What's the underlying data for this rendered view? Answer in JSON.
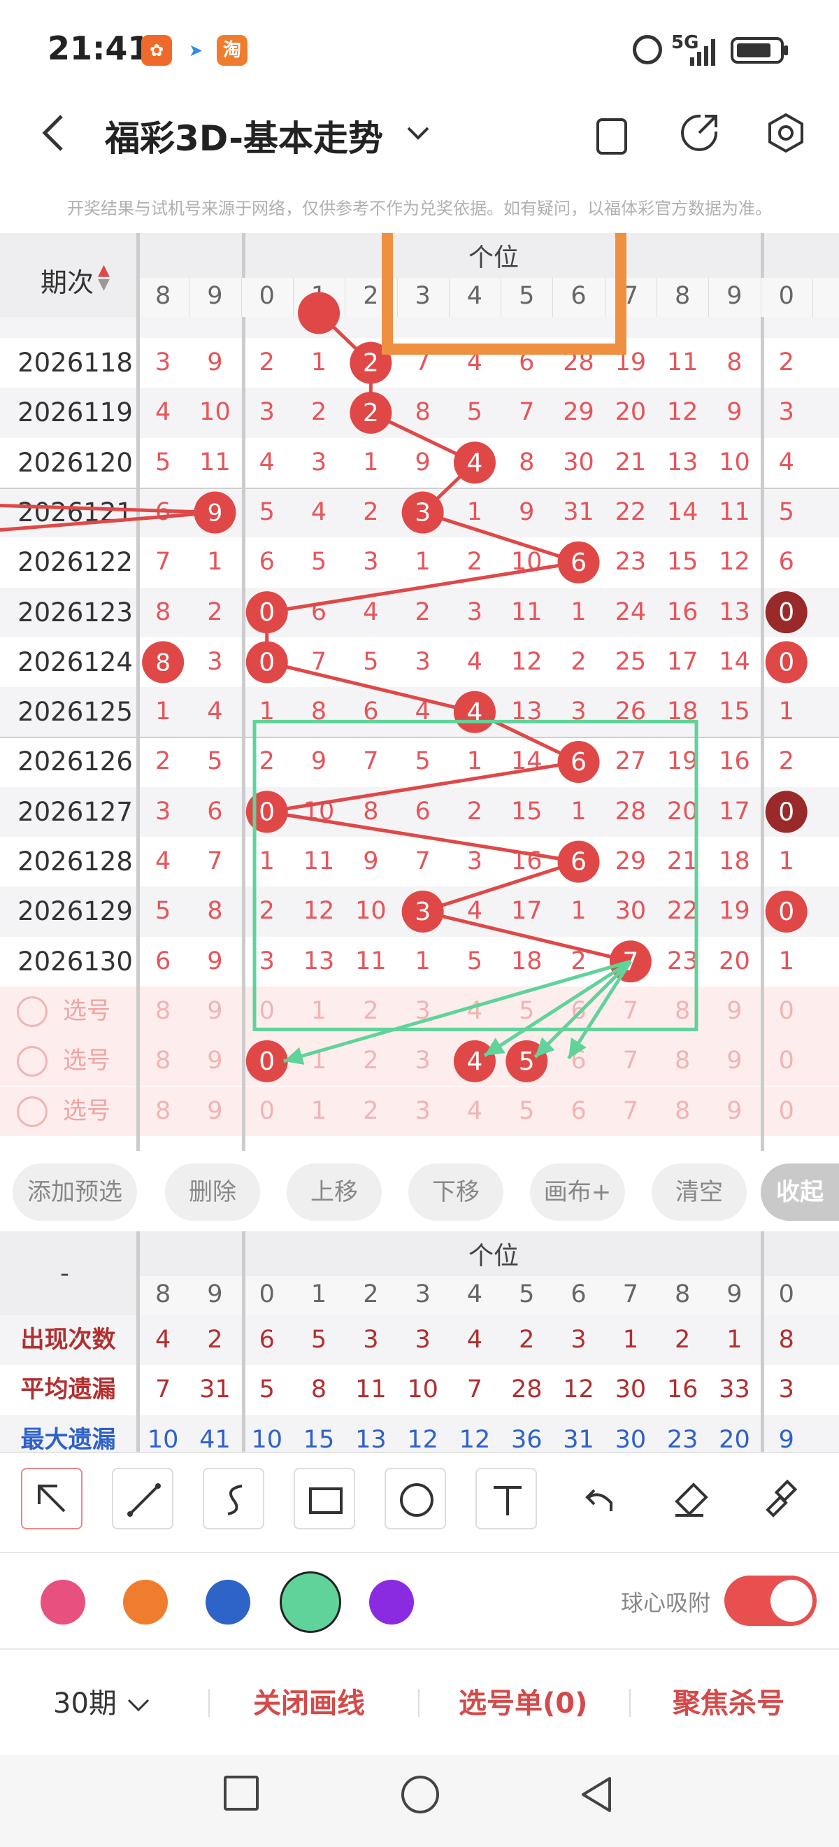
{
  "status_bar": {
    "time": "21:41",
    "signal": "5G",
    "app_icons": [
      "photo-app-icon",
      "bird-app-icon",
      "taobao-app-icon"
    ]
  },
  "header": {
    "title": "福彩3D-基本走势",
    "notice": "开奖结果与试机号来源于网络，仅供参考不作为兑奖依据。如有疑问，以福体彩官方数据为准。"
  },
  "table": {
    "period_header": "期次",
    "group_label": "个位",
    "columns": [
      "8",
      "9",
      "0",
      "1",
      "2",
      "3",
      "4",
      "5",
      "6",
      "7",
      "8",
      "9",
      "0"
    ],
    "rows": [
      {
        "period": "2026118",
        "cells": [
          "3",
          "9",
          "2",
          "1",
          "2",
          "7",
          "4",
          "6",
          "28",
          "19",
          "11",
          "8",
          "2"
        ],
        "ball_index": 4,
        "ball_value": "2"
      },
      {
        "period": "2026119",
        "cells": [
          "4",
          "10",
          "3",
          "2",
          "2",
          "8",
          "5",
          "7",
          "29",
          "20",
          "12",
          "9",
          "3"
        ],
        "ball_index": 4,
        "ball_value": "2"
      },
      {
        "period": "2026120",
        "cells": [
          "5",
          "11",
          "4",
          "3",
          "1",
          "9",
          "4",
          "8",
          "30",
          "21",
          "13",
          "10",
          "4"
        ],
        "ball_index": 6,
        "ball_value": "4"
      },
      {
        "period": "2026121",
        "cells": [
          "6",
          "9",
          "5",
          "4",
          "2",
          "3",
          "1",
          "9",
          "31",
          "22",
          "14",
          "11",
          "5"
        ],
        "ball_index": 5,
        "ball_value": "3"
      },
      {
        "period": "2026122",
        "cells": [
          "7",
          "1",
          "6",
          "5",
          "3",
          "1",
          "2",
          "10",
          "6",
          "23",
          "15",
          "12",
          "6"
        ],
        "ball_index": 8,
        "ball_value": "6"
      },
      {
        "period": "2026123",
        "cells": [
          "8",
          "2",
          "0",
          "6",
          "4",
          "2",
          "3",
          "11",
          "1",
          "24",
          "16",
          "13",
          "0"
        ],
        "ball_index": 2,
        "ball_value": "0"
      },
      {
        "period": "2026124",
        "cells": [
          "8",
          "3",
          "0",
          "7",
          "5",
          "3",
          "4",
          "12",
          "2",
          "25",
          "17",
          "14",
          "0"
        ],
        "ball_index": 2,
        "ball_value": "0"
      },
      {
        "period": "2026125",
        "cells": [
          "1",
          "4",
          "1",
          "8",
          "6",
          "4",
          "4",
          "13",
          "3",
          "26",
          "18",
          "15",
          "1"
        ],
        "ball_index": 6,
        "ball_value": "4"
      },
      {
        "period": "2026126",
        "cells": [
          "2",
          "5",
          "2",
          "9",
          "7",
          "5",
          "1",
          "14",
          "6",
          "27",
          "19",
          "16",
          "2"
        ],
        "ball_index": 8,
        "ball_value": "6"
      },
      {
        "period": "2026127",
        "cells": [
          "3",
          "6",
          "0",
          "10",
          "8",
          "6",
          "2",
          "15",
          "1",
          "28",
          "20",
          "17",
          "0"
        ],
        "ball_index": 2,
        "ball_value": "0"
      },
      {
        "period": "2026128",
        "cells": [
          "4",
          "7",
          "1",
          "11",
          "9",
          "7",
          "3",
          "16",
          "6",
          "29",
          "21",
          "18",
          "1"
        ],
        "ball_index": 8,
        "ball_value": "6"
      },
      {
        "period": "2026129",
        "cells": [
          "5",
          "8",
          "2",
          "12",
          "10",
          "3",
          "4",
          "17",
          "1",
          "30",
          "22",
          "19",
          "0"
        ],
        "ball_index": 5,
        "ball_value": "3"
      },
      {
        "period": "2026130",
        "cells": [
          "6",
          "9",
          "3",
          "13",
          "11",
          "1",
          "5",
          "18",
          "2",
          "7",
          "23",
          "20",
          "1"
        ],
        "ball_index": 9,
        "ball_value": "7"
      }
    ],
    "select_label": "选号",
    "select_row_values": [
      "8",
      "9",
      "0",
      "1",
      "2",
      "3",
      "4",
      "5",
      "6",
      "7",
      "8",
      "9",
      "0"
    ]
  },
  "actions": {
    "add": "添加预选",
    "delete": "删除",
    "up": "上移",
    "down": "下移",
    "canvas": "画布+",
    "clear": "清空",
    "collapse": "收起"
  },
  "stats": {
    "dash": "-",
    "group_label": "个位",
    "columns": [
      "8",
      "9",
      "0",
      "1",
      "2",
      "3",
      "4",
      "5",
      "6",
      "7",
      "8",
      "9",
      "0"
    ],
    "rows": [
      {
        "label": "出现次数",
        "values": [
          "4",
          "2",
          "6",
          "5",
          "3",
          "3",
          "4",
          "2",
          "3",
          "1",
          "2",
          "1",
          "8"
        ],
        "color": "#b22f2f"
      },
      {
        "label": "平均遗漏",
        "values": [
          "7",
          "31",
          "5",
          "8",
          "11",
          "10",
          "7",
          "28",
          "12",
          "30",
          "16",
          "33",
          "3"
        ],
        "color": "#b22f2f"
      },
      {
        "label": "最大遗漏",
        "values": [
          "10",
          "41",
          "10",
          "15",
          "13",
          "12",
          "12",
          "36",
          "31",
          "30",
          "23",
          "20",
          "9"
        ],
        "color": "#2f62c8"
      }
    ]
  },
  "toolbar": {
    "tools": [
      "arrow-tool-icon",
      "line-tool-icon",
      "curve-tool-icon",
      "rect-tool-icon",
      "circle-tool-icon",
      "text-tool-icon",
      "undo-icon",
      "eraser-icon",
      "brush-clear-icon"
    ],
    "colors": [
      "#e8517f",
      "#ef7d2d",
      "#2e64c8",
      "#5fd39a",
      "#8a2be2"
    ],
    "selected_color": 3,
    "snap_label": "球心吸附",
    "snap_on": true
  },
  "bottom": {
    "periods": "30期",
    "close_draw": "关闭画线",
    "picks": "选号单(0)",
    "focus": "聚焦杀号"
  }
}
